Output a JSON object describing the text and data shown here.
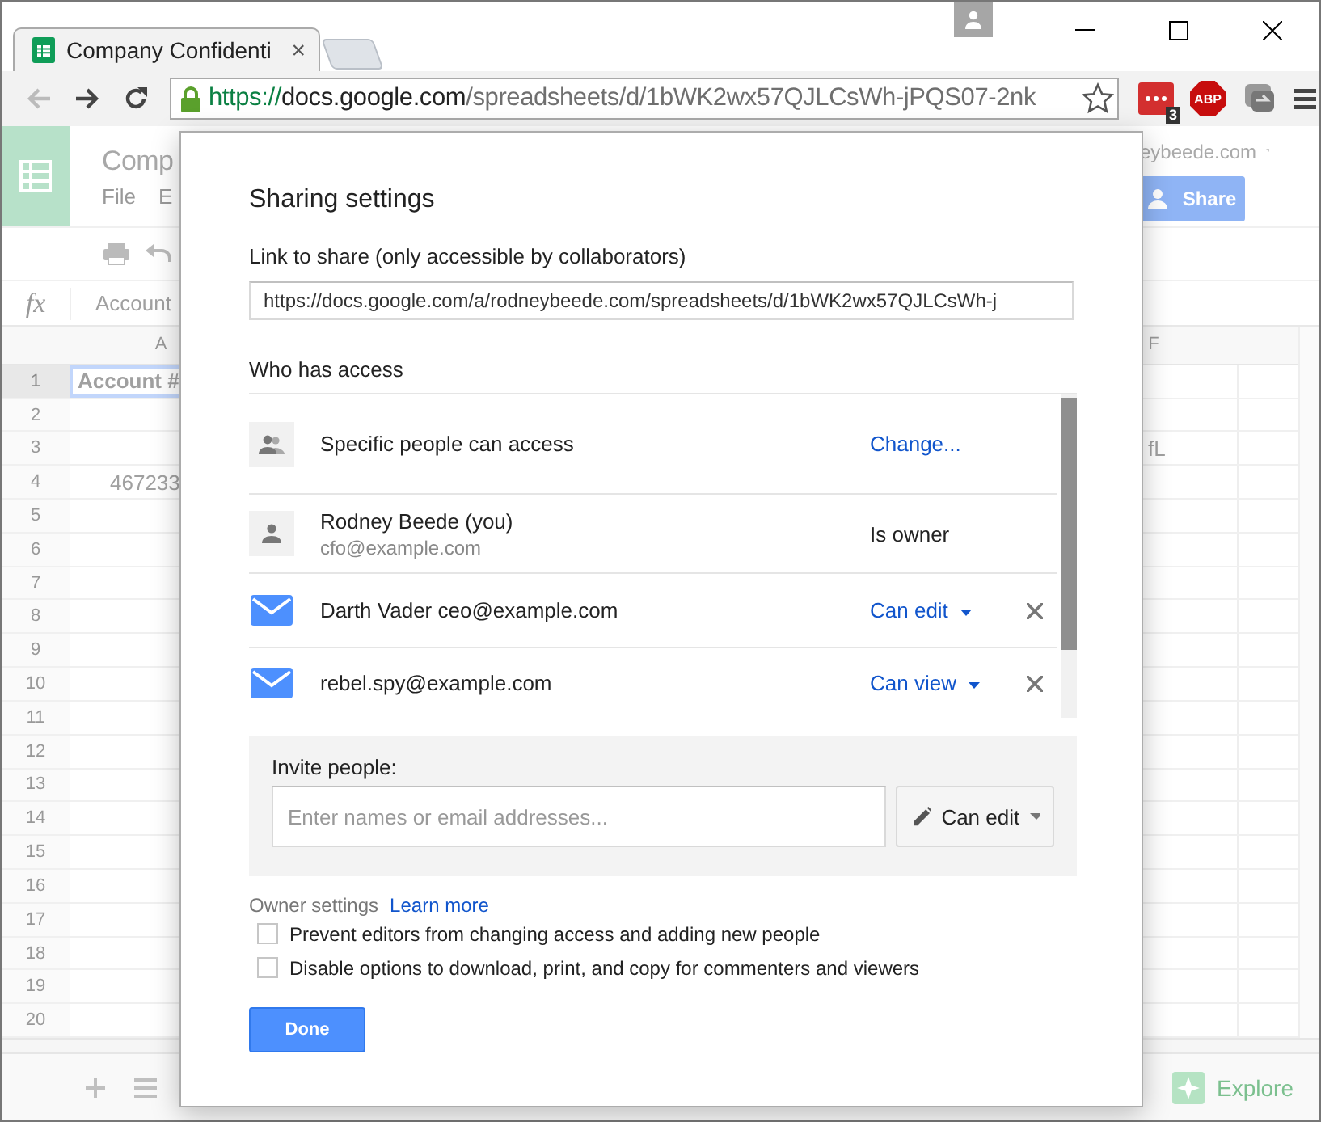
{
  "browser": {
    "tab_title": "Company Confidenti",
    "tab_close": "×",
    "url": {
      "scheme": "https://",
      "host": "docs.google.com",
      "path": "/spreadsheets/d/1bWK2wx57QJLCsWh-jPQS07-2nk"
    },
    "extension_badge": "3",
    "adblock_label": "ABP"
  },
  "sheet": {
    "title": "Comp",
    "menu": [
      "File",
      "E"
    ],
    "account": "eybeede.com",
    "share_button": "Share",
    "formula_icon": "fx",
    "formula": "Account",
    "columns": [
      {
        "label": "A",
        "kind": "a"
      },
      {
        "label": "F",
        "kind": "f"
      }
    ],
    "rows": [
      {
        "number": "1",
        "selected": true,
        "cell_a": "Account #"
      },
      {
        "number": "2",
        "selected": false
      },
      {
        "number": "3",
        "selected": false,
        "cell_f": "fL"
      },
      {
        "number": "4",
        "selected": false,
        "cell_a": "467233"
      },
      {
        "number": "5",
        "selected": false
      },
      {
        "number": "6",
        "selected": false
      },
      {
        "number": "7",
        "selected": false
      },
      {
        "number": "8",
        "selected": false
      },
      {
        "number": "9",
        "selected": false
      },
      {
        "number": "10",
        "selected": false
      },
      {
        "number": "11",
        "selected": false
      },
      {
        "number": "12",
        "selected": false
      },
      {
        "number": "13",
        "selected": false
      },
      {
        "number": "14",
        "selected": false
      },
      {
        "number": "15",
        "selected": false
      },
      {
        "number": "16",
        "selected": false
      },
      {
        "number": "17",
        "selected": false
      },
      {
        "number": "18",
        "selected": false
      },
      {
        "number": "19",
        "selected": false
      },
      {
        "number": "20",
        "selected": false
      }
    ],
    "explore_button": "Explore"
  },
  "dialog": {
    "title": "Sharing settings",
    "link_label": "Link to share (only accessible by collaborators)",
    "link_url": "https://docs.google.com/a/rodneybeede.com/spreadsheets/d/1bWK2wx57QJLCsWh-j",
    "access_heading": "Who has access",
    "access": [
      {
        "kind": "visibility",
        "name": "Specific people can access",
        "action": "Change..."
      },
      {
        "kind": "owner",
        "name": "Rodney Beede (you)",
        "email": "cfo@example.com",
        "role": "Is owner"
      },
      {
        "kind": "invitee",
        "name": "Darth Vader ceo@example.com",
        "role": "Can edit"
      },
      {
        "kind": "invitee",
        "name": "rebel.spy@example.com",
        "role": "Can view"
      }
    ],
    "invite": {
      "label": "Invite people:",
      "placeholder": "Enter names or email addresses...",
      "permission": "Can edit"
    },
    "owner_settings": {
      "label": "Owner settings",
      "link": "Learn more",
      "options": [
        {
          "label": "Prevent editors from changing access and adding new people",
          "checked": false
        },
        {
          "label": "Disable options to download, print, and copy for commenters and viewers",
          "checked": false
        }
      ]
    },
    "done_button": "Done"
  }
}
